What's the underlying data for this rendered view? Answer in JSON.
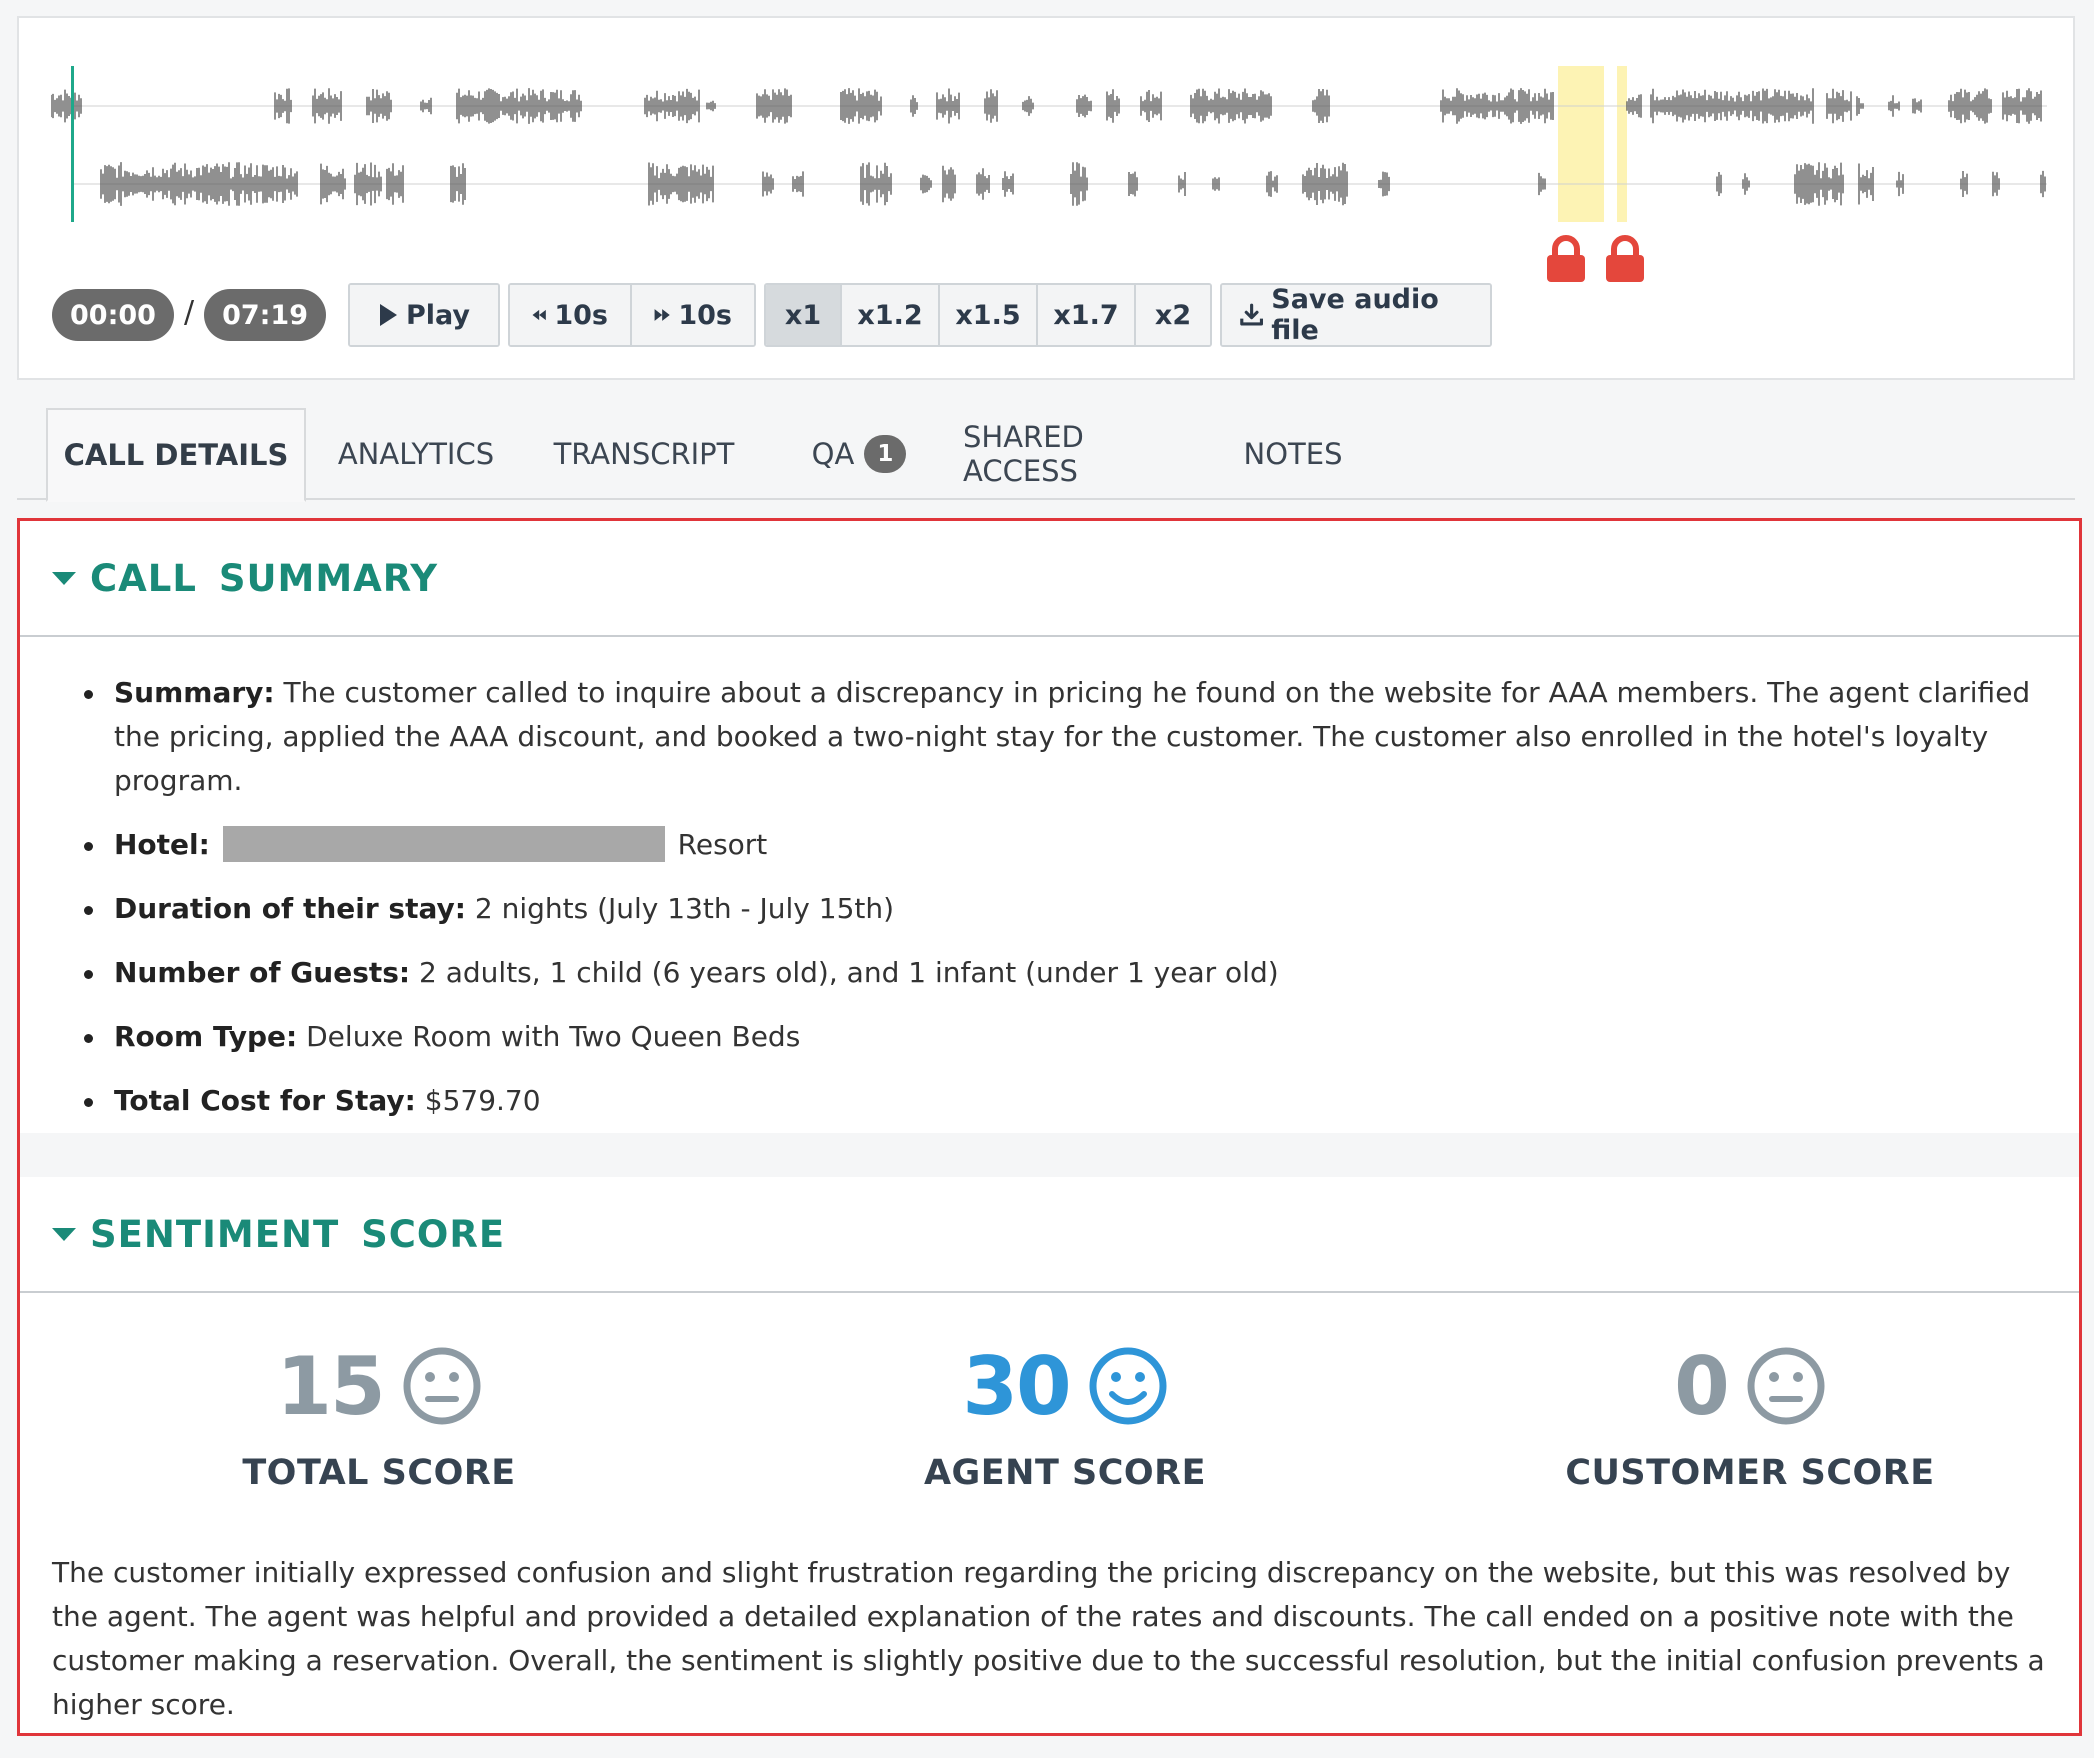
{
  "player": {
    "current_time": "00:00",
    "separator": "/",
    "total_time": "07:19",
    "play_label": "Play",
    "rewind_label": "10s",
    "forward_label": "10s",
    "speeds": [
      "x1",
      "x1.2",
      "x1.5",
      "x1.7",
      "x2"
    ],
    "active_speed": "x1",
    "save_label": "Save audio file",
    "colors": {
      "playhead": "#1fa88a",
      "highlight": "#fdf3b4",
      "lock": "#e4473c",
      "waveform": "#555555"
    }
  },
  "tabs": [
    {
      "label": "CALL DETAILS",
      "active": true
    },
    {
      "label": "ANALYTICS"
    },
    {
      "label": "TRANSCRIPT"
    },
    {
      "label": "QA",
      "badge": "1"
    },
    {
      "label": "SHARED ACCESS"
    },
    {
      "label": "NOTES"
    }
  ],
  "call_summary": {
    "title": "CALL SUMMARY",
    "items": [
      {
        "label": "Summary:",
        "value": "The customer called to inquire about a discrepancy in pricing he found on the website for AAA members. The agent clarified the pricing, applied the AAA discount, and booked a two-night stay for the customer. The customer also enrolled in the hotel's loyalty program."
      },
      {
        "label": "Hotel:",
        "value": "Resort",
        "redacted": true
      },
      {
        "label": "Duration of their stay:",
        "value": "2 nights (July 13th - July 15th)"
      },
      {
        "label": "Number of Guests:",
        "value": "2 adults, 1 child (6 years old), and 1 infant (under 1 year old)"
      },
      {
        "label": "Room Type:",
        "value": "Deluxe Room with Two Queen Beds"
      },
      {
        "label": "Total Cost for Stay:",
        "value": "$579.70"
      }
    ]
  },
  "sentiment": {
    "title": "SENTIMENT SCORE",
    "scores": [
      {
        "value": "15",
        "label": "TOTAL SCORE",
        "face": "neutral-face-icon"
      },
      {
        "value": "30",
        "label": "AGENT SCORE",
        "face": "smile-face-icon"
      },
      {
        "value": "0",
        "label": "CUSTOMER SCORE",
        "face": "neutral-face-icon"
      }
    ],
    "colors": {
      "neutral": "#8d9aa3",
      "positive": "#2e95d8"
    },
    "text": "The customer initially expressed confusion and slight frustration regarding the pricing discrepancy on the website, but this was resolved by the agent. The agent was helpful and provided a detailed explanation of the rates and discounts. The call ended on a positive note with the customer making a reservation. Overall, the sentiment is slightly positive due to the successful resolution, but the initial confusion prevents a higher score."
  }
}
